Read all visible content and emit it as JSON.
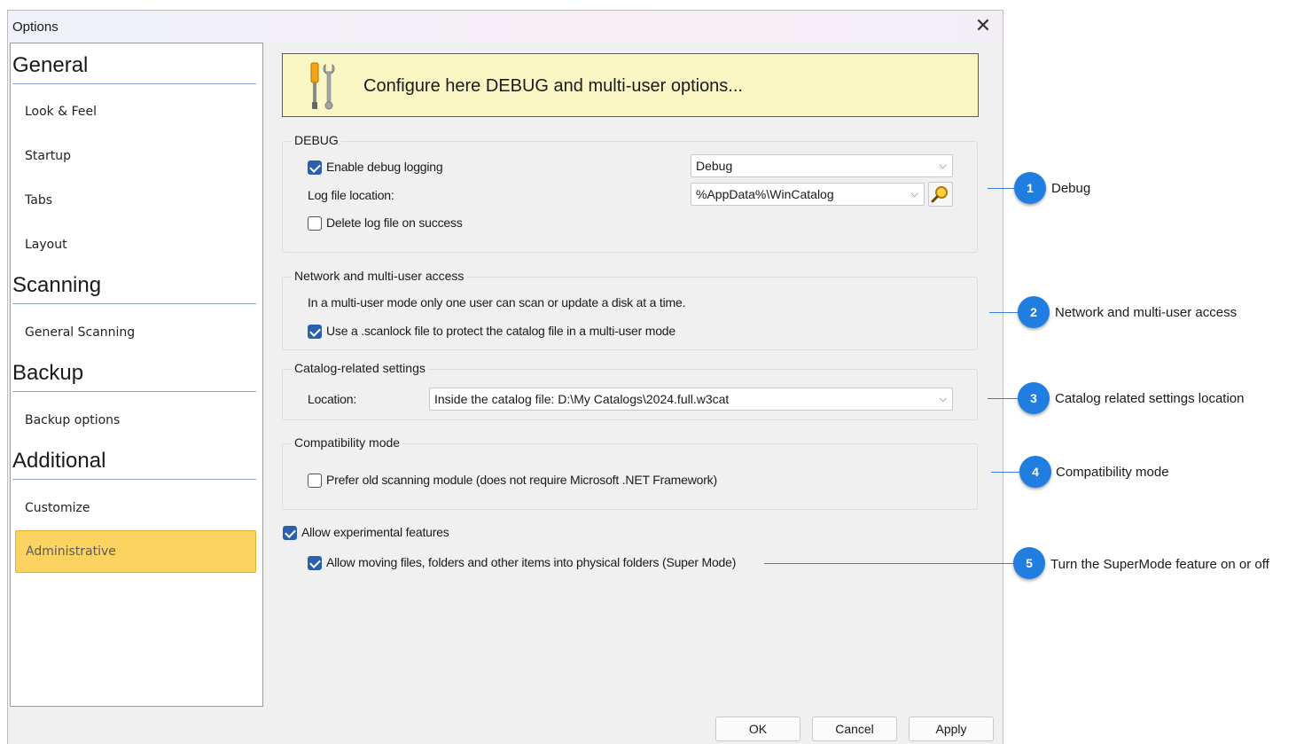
{
  "window": {
    "title": "Options",
    "close_glyph": "✕"
  },
  "sidebar": {
    "sections": [
      {
        "heading": "General",
        "items": [
          "Look & Feel",
          "Startup",
          "Tabs",
          "Layout"
        ]
      },
      {
        "heading": "Scanning",
        "items": [
          "General Scanning"
        ]
      },
      {
        "heading": "Backup",
        "items": [
          "Backup options"
        ]
      },
      {
        "heading": "Additional",
        "items": [
          "Customize",
          "Administrative"
        ]
      }
    ],
    "selected": "Administrative"
  },
  "banner": {
    "text": "Configure here DEBUG and multi-user options...",
    "icon": "tools-icon"
  },
  "debug": {
    "legend": "DEBUG",
    "enable_logging": {
      "label": "Enable debug logging",
      "checked": true
    },
    "log_level": "Debug",
    "log_location_label": "Log file location:",
    "log_location": "%AppData%\\WinCatalog",
    "delete_on_success": {
      "label": "Delete log file on success",
      "checked": false
    }
  },
  "network": {
    "legend": "Network and multi-user access",
    "info": "In a multi-user mode only one user can scan or update a disk at a time.",
    "scanlock": {
      "label": "Use a .scanlock file to protect the catalog file in a multi-user mode",
      "checked": true
    }
  },
  "catalog": {
    "legend": "Catalog-related settings",
    "location_label": "Location:",
    "location_value": "Inside the catalog file: D:\\My Catalogs\\2024.full.w3cat"
  },
  "compat": {
    "legend": "Compatibility mode",
    "old_module": {
      "label": "Prefer old scanning module (does not require Microsoft .NET Framework)",
      "checked": false
    }
  },
  "experimental": {
    "allow": {
      "label": "Allow experimental features",
      "checked": true
    },
    "super_mode": {
      "label": "Allow moving files, folders and other items into physical folders (Super Mode)",
      "checked": true
    }
  },
  "buttons": {
    "ok": "OK",
    "cancel": "Cancel",
    "apply": "Apply"
  },
  "callouts": [
    {
      "num": "1",
      "text": "Debug"
    },
    {
      "num": "2",
      "text": "Network and multi-user access"
    },
    {
      "num": "3",
      "text": "Catalog related settings location"
    },
    {
      "num": "4",
      "text": "Compatibility mode"
    },
    {
      "num": "5",
      "text": "Turn the SuperMode feature on or off"
    }
  ],
  "colors": {
    "accent": "#1f7ee0",
    "selected": "#fcd361",
    "banner": "#fbf7c4",
    "checkbox": "#2a5fb0"
  }
}
